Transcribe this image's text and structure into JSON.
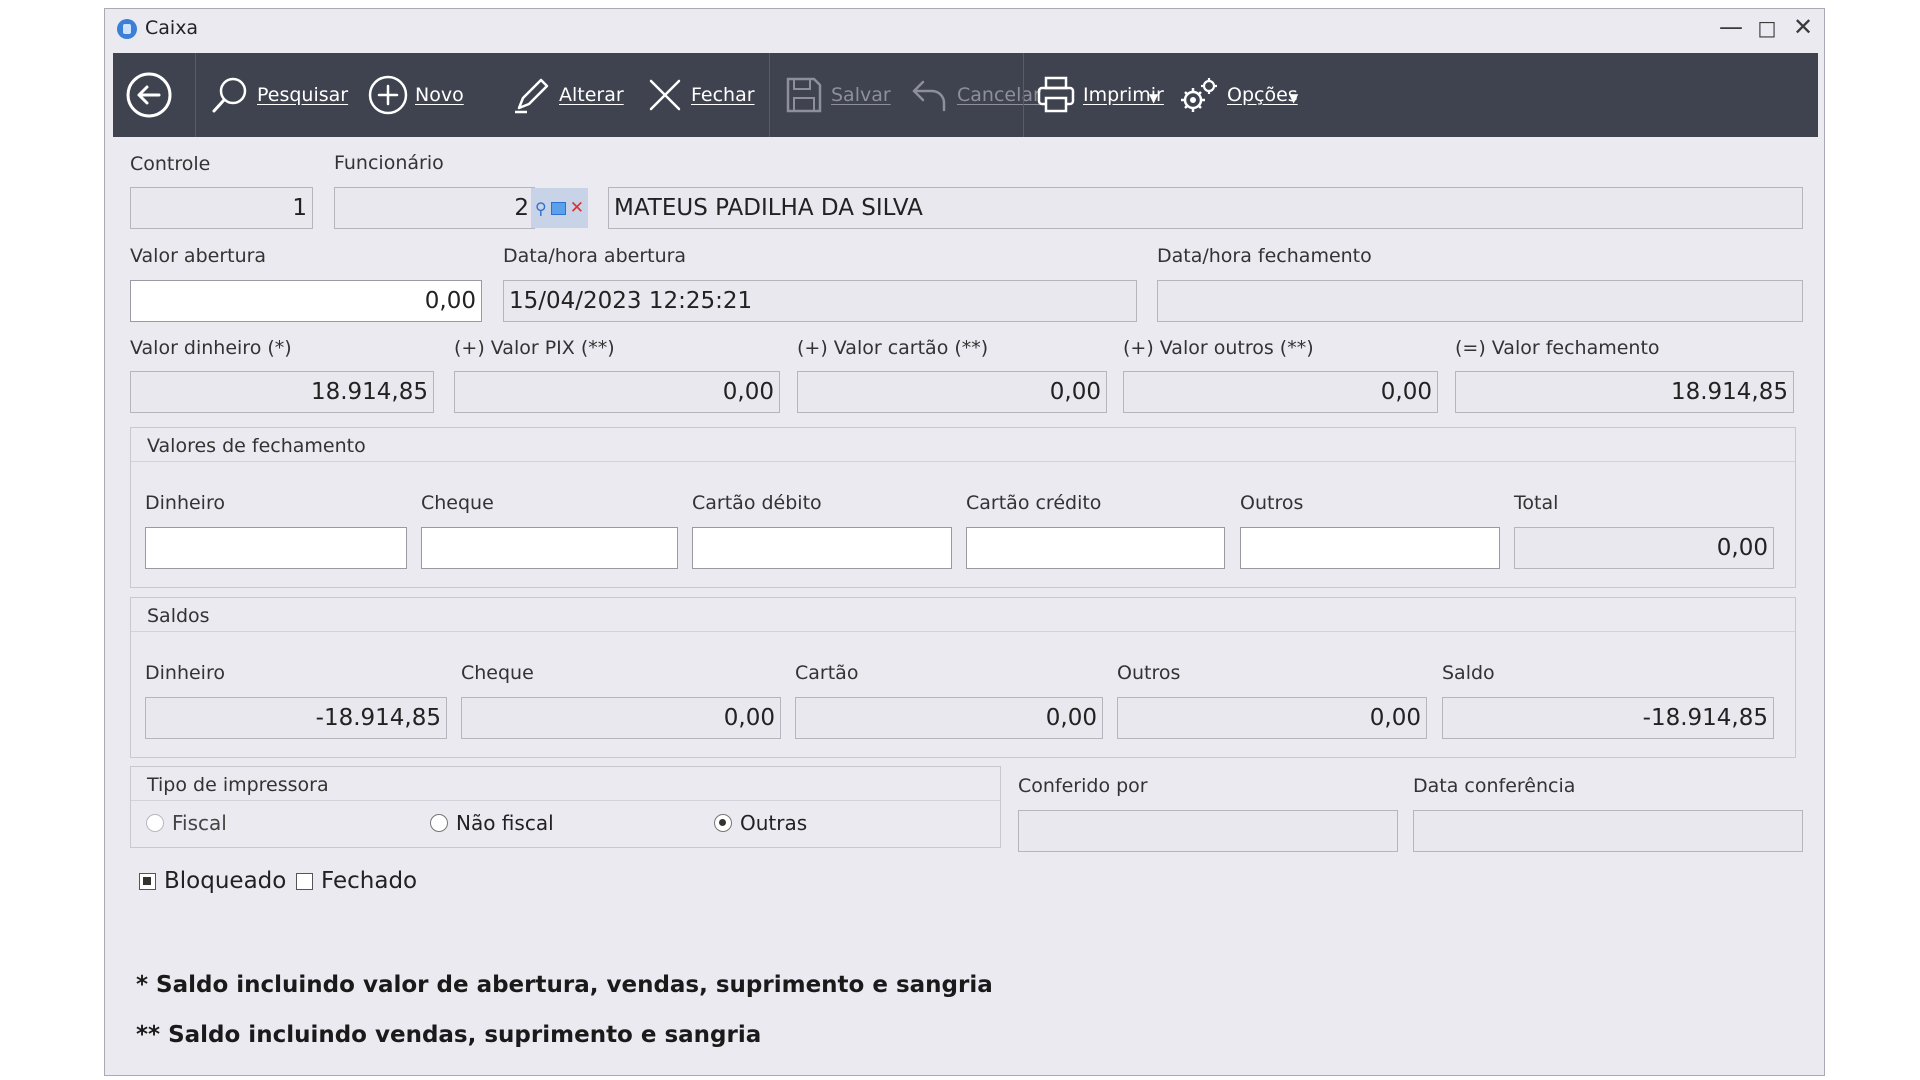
{
  "window": {
    "title": "Caixa"
  },
  "toolbar": {
    "pesquisar": "Pesquisar",
    "novo": "Novo",
    "alterar": "Alterar",
    "fechar": "Fechar",
    "salvar": "Salvar",
    "cancelar": "Cancelar",
    "imprimir": "Imprimir",
    "opcoes": "Opções"
  },
  "form": {
    "controle": {
      "label": "Controle",
      "value": "1"
    },
    "funcionario": {
      "label": "Funcionário",
      "code": "2",
      "name": "MATEUS PADILHA DA SILVA"
    },
    "valor_abertura": {
      "label": "Valor abertura",
      "value": "0,00"
    },
    "data_abertura": {
      "label": "Data/hora abertura",
      "value": "15/04/2023 12:25:21"
    },
    "data_fechamento": {
      "label": "Data/hora fechamento",
      "value": ""
    },
    "valor_dinheiro": {
      "label": "Valor dinheiro (*)",
      "value": "18.914,85"
    },
    "valor_pix": {
      "label": "(+) Valor PIX (**)",
      "value": "0,00"
    },
    "valor_cartao": {
      "label": "(+) Valor cartão (**)",
      "value": "0,00"
    },
    "valor_outros": {
      "label": "(+) Valor outros (**)",
      "value": "0,00"
    },
    "valor_fechamento": {
      "label": "(=) Valor fechamento",
      "value": "18.914,85"
    }
  },
  "fechamento": {
    "title": "Valores de fechamento",
    "dinheiro": {
      "label": "Dinheiro",
      "value": ""
    },
    "cheque": {
      "label": "Cheque",
      "value": ""
    },
    "cartao_debito": {
      "label": "Cartão débito",
      "value": ""
    },
    "cartao_credito": {
      "label": "Cartão crédito",
      "value": ""
    },
    "outros": {
      "label": "Outros",
      "value": ""
    },
    "total": {
      "label": "Total",
      "value": "0,00"
    }
  },
  "saldos": {
    "title": "Saldos",
    "dinheiro": {
      "label": "Dinheiro",
      "value": "-18.914,85"
    },
    "cheque": {
      "label": "Cheque",
      "value": "0,00"
    },
    "cartao": {
      "label": "Cartão",
      "value": "0,00"
    },
    "outros": {
      "label": "Outros",
      "value": "0,00"
    },
    "saldo": {
      "label": "Saldo",
      "value": "-18.914,85"
    }
  },
  "impressora": {
    "title": "Tipo de impressora",
    "options": [
      "Fiscal",
      "Não fiscal",
      "Outras"
    ],
    "selected": "Outras"
  },
  "conferido_por": {
    "label": "Conferido por",
    "value": ""
  },
  "data_conferencia": {
    "label": "Data conferência",
    "value": ""
  },
  "flags": {
    "bloqueado": {
      "label": "Bloqueado",
      "checked": true
    },
    "fechado": {
      "label": "Fechado",
      "checked": false
    }
  },
  "notes": {
    "note1": "*  Saldo incluindo valor de abertura, vendas, suprimento e sangria",
    "note2": "** Saldo incluindo vendas, suprimento e sangria"
  }
}
